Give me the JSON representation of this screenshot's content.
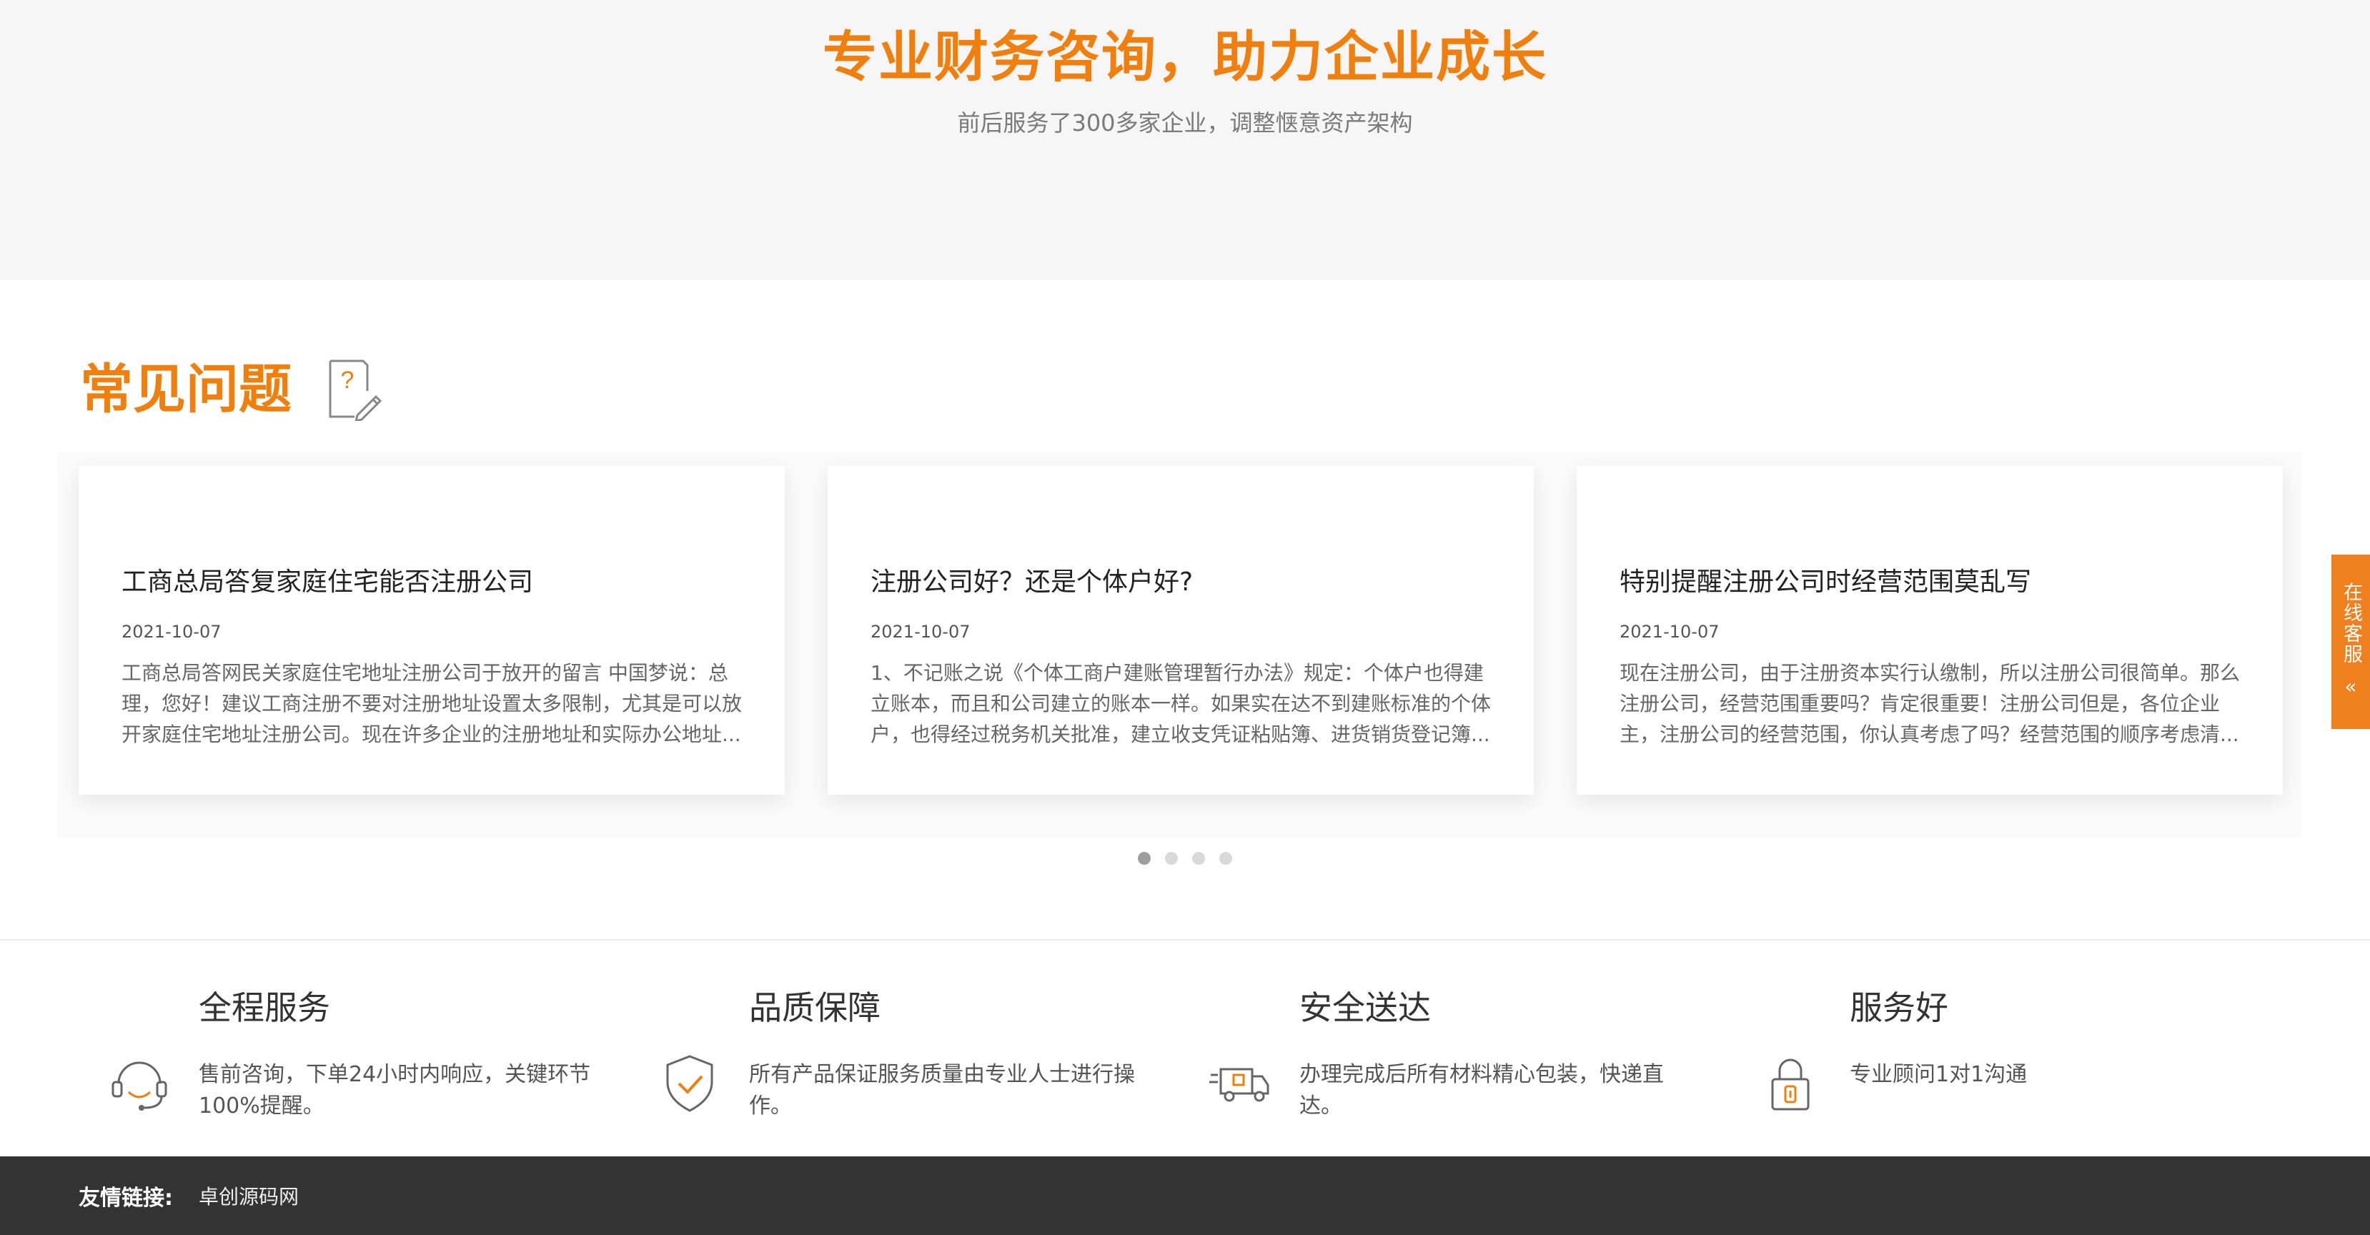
{
  "hero": {
    "title": "专业财务咨询，助力企业成长",
    "subtitle": "前后服务了300多家企业，调整惬意资产架构"
  },
  "faq": {
    "title": "常见问题",
    "icon": "question-note-icon",
    "cards": [
      {
        "title": "工商总局答复家庭住宅能否注册公司",
        "date": "2021-10-07",
        "excerpt": "工商总局答网民关家庭住宅地址注册公司于放开的留言 中国梦说：总理，您好！建议工商注册不要对注册地址设置太多限制，尤其是可以放开家庭住宅地址注册公司。现在许多企业的注册地址和实际办公地址..."
      },
      {
        "title": "注册公司好？还是个体户好?",
        "date": "2021-10-07",
        "excerpt": "1、不记账之说《个体工商户建账管理暂行办法》规定：个体户也得建立账本，而且和公司建立的账本一样。如果实在达不到建账标准的个体户，也得经过税务机关批准，建立收支凭证粘贴簿、进货销货登记簿..."
      },
      {
        "title": "特别提醒注册公司时经营范围莫乱写",
        "date": "2021-10-07",
        "excerpt": "现在注册公司，由于注册资本实行认缴制，所以注册公司很简单。那么注册公司，经营范围重要吗？肯定很重要！注册公司但是，各位企业主，注册公司的经营范围，你认真考虑了吗？经营范围的顺序考虑清..."
      }
    ],
    "carousel": {
      "page_count": 4,
      "active_index": 0
    }
  },
  "side_chat": {
    "label": "在线客服",
    "arrow": "«",
    "icon": "double-chevron-left-icon"
  },
  "features": [
    {
      "title": "全程服务",
      "desc": "售前咨询，下单24小时内响应，关键环节100%提醒。",
      "icon": "headset-icon"
    },
    {
      "title": "品质保障",
      "desc": "所有产品保证服务质量由专业人士进行操作。",
      "icon": "shield-check-icon"
    },
    {
      "title": "安全送达",
      "desc": "办理完成后所有材料精心包装，快递直达。",
      "icon": "delivery-truck-icon"
    },
    {
      "title": "服务好",
      "desc": "专业顾问1对1沟通",
      "icon": "lock-icon"
    }
  ],
  "footer": {
    "label": "友情链接:",
    "links": [
      "卓创源码网"
    ]
  },
  "colors": {
    "accent": "#f07f0d",
    "footer_bg": "#333333",
    "hero_bg": "#f6f6f6"
  }
}
